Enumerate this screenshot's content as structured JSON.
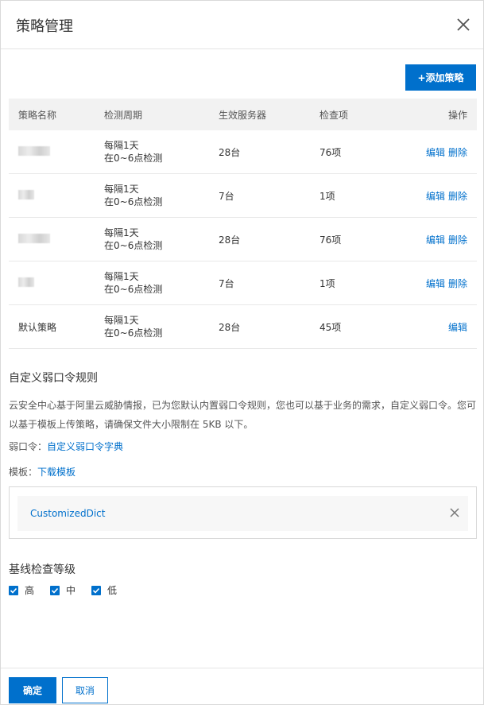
{
  "dialog": {
    "title": "策略管理"
  },
  "toolbar": {
    "add_label": "+添加策略"
  },
  "table": {
    "headers": {
      "name": "策略名称",
      "cycle": "检测周期",
      "servers": "生效服务器",
      "checks": "检查项",
      "ops": "操作"
    },
    "rows": [
      {
        "name": "",
        "cycle1": "每隔1天",
        "cycle2": "在0~6点检测",
        "servers": "28台",
        "checks": "76项",
        "edit": "编辑",
        "delete": "删除"
      },
      {
        "name": "",
        "cycle1": "每隔1天",
        "cycle2": "在0~6点检测",
        "servers": "7台",
        "checks": "1项",
        "edit": "编辑",
        "delete": "删除"
      },
      {
        "name": "",
        "cycle1": "每隔1天",
        "cycle2": "在0~6点检测",
        "servers": "28台",
        "checks": "76项",
        "edit": "编辑",
        "delete": "删除"
      },
      {
        "name": "",
        "cycle1": "每隔1天",
        "cycle2": "在0~6点检测",
        "servers": "7台",
        "checks": "1项",
        "edit": "编辑",
        "delete": "删除"
      },
      {
        "name": "默认策略",
        "cycle1": "每隔1天",
        "cycle2": "在0~6点检测",
        "servers": "28台",
        "checks": "45项",
        "edit": "编辑"
      }
    ]
  },
  "weak_password": {
    "title": "自定义弱口令规则",
    "desc_line1": "云安全中心基于阿里云威胁情报，已为您默认内置弱口令规则，您也可以基于业务的需求，自定义弱口令。您可",
    "desc_line2": "以基于模板上传策略，请确保文件大小限制在 5KB 以下。",
    "dict_label": "弱口令：",
    "dict_link": "自定义弱口令字典",
    "template_label": "模板：",
    "template_link": "下载模板",
    "file_name": "CustomizedDict"
  },
  "baseline": {
    "title": "基线检查等级",
    "levels": [
      {
        "label": "高",
        "checked": true
      },
      {
        "label": "中",
        "checked": true
      },
      {
        "label": "低",
        "checked": true
      }
    ]
  },
  "footer": {
    "ok_label": "确定",
    "cancel_label": "取消"
  },
  "colors": {
    "primary": "#0070cc",
    "header_bg": "#f2f2f2"
  }
}
